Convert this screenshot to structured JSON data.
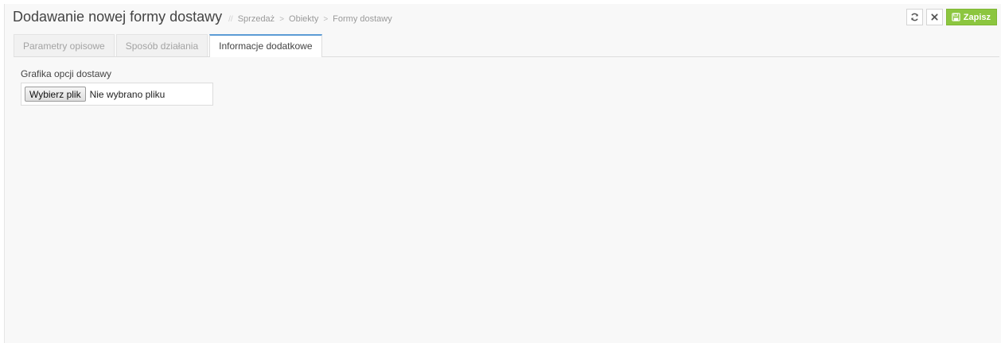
{
  "header": {
    "title": "Dodawanie nowej formy dostawy",
    "breadcrumb_separator": "//",
    "breadcrumb": [
      "Sprzedaż",
      "Obiekty",
      "Formy dostawy"
    ],
    "crumb_separator": ">"
  },
  "toolbar": {
    "refresh_icon": "refresh-icon",
    "close_icon": "close-icon",
    "save_icon": "floppy-disk-icon",
    "save_label": "Zapisz",
    "save_color": "#8cc63f"
  },
  "tabs": [
    {
      "label": "Parametry opisowe",
      "active": false
    },
    {
      "label": "Sposób działania",
      "active": false
    },
    {
      "label": "Informacje dodatkowe",
      "active": true
    }
  ],
  "form": {
    "field_label": "Grafika opcji dostawy",
    "file_button_label": "Wybierz plik",
    "file_status": "Nie wybrano pliku"
  },
  "colors": {
    "accent_tab": "#5b9bd5",
    "background": "#f8f8f8"
  }
}
